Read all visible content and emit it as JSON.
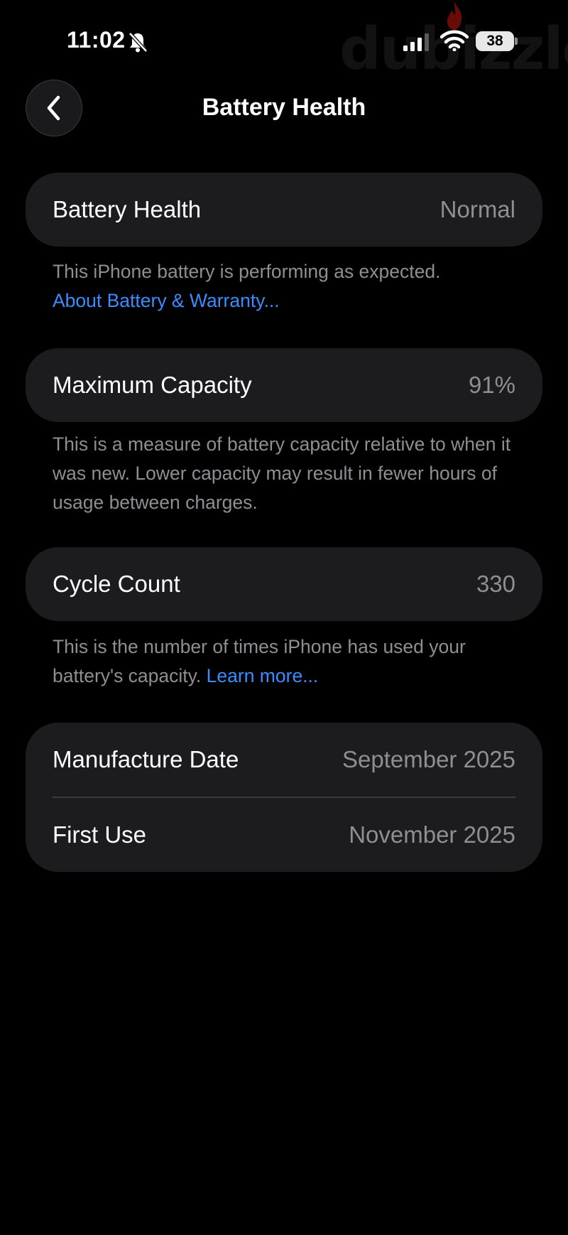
{
  "status_bar": {
    "time": "11:02",
    "battery_level": "38",
    "icons": [
      "bell-slash-icon",
      "cellular-signal-icon",
      "wifi-icon",
      "battery-icon"
    ]
  },
  "watermark": "dubizzle",
  "nav": {
    "title": "Battery Health",
    "back_icon": "chevron-left-icon"
  },
  "battery_health": {
    "label": "Battery Health",
    "value": "Normal",
    "description": "This iPhone battery is performing as expected.",
    "link": "About Battery & Warranty..."
  },
  "maximum_capacity": {
    "label": "Maximum Capacity",
    "value": "91%",
    "description": "This is a measure of battery capacity relative to when it was new. Lower capacity may result in fewer hours of usage between charges."
  },
  "cycle_count": {
    "label": "Cycle Count",
    "value": "330",
    "description": "This is the number of times iPhone has used your battery's capacity.",
    "link": "Learn more..."
  },
  "dates": {
    "manufacture_label": "Manufacture Date",
    "manufacture_value": "September 2025",
    "first_use_label": "First Use",
    "first_use_value": "November 2025"
  },
  "colors": {
    "background": "#000000",
    "card": "#1c1c1e",
    "secondary_text": "#8e8e93",
    "link": "#3b8cff"
  }
}
